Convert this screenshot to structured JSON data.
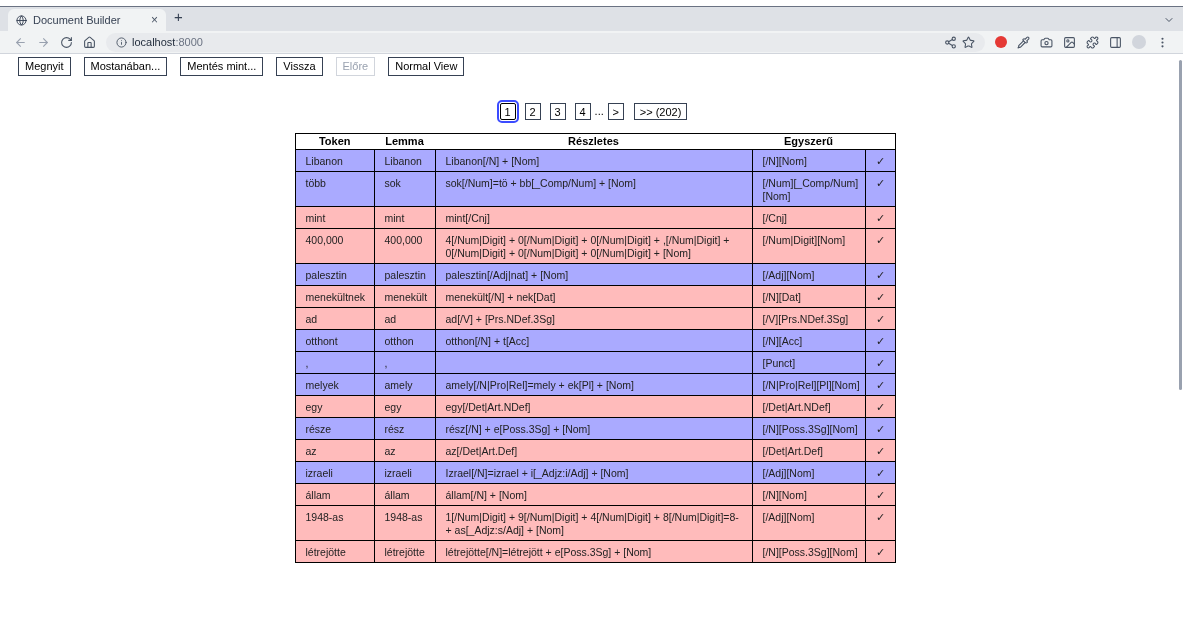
{
  "browser": {
    "tab_title": "Document Builder",
    "tab_close": "×",
    "new_tab": "+",
    "url_host": "localhost",
    "url_port": ":8000"
  },
  "toolbar": [
    {
      "label": "Megnyit",
      "disabled": false
    },
    {
      "label": "Mostanában...",
      "disabled": false
    },
    {
      "label": "Mentés mint...",
      "disabled": false
    },
    {
      "label": "Vissza",
      "disabled": false
    },
    {
      "label": "Előre",
      "disabled": true
    },
    {
      "label": "Normal View",
      "disabled": false
    }
  ],
  "pagination": {
    "pages": [
      {
        "label": "1",
        "selected": true
      },
      {
        "label": "2",
        "selected": false
      },
      {
        "label": "3",
        "selected": false
      },
      {
        "label": "4",
        "selected": false
      }
    ],
    "ellipsis": "...",
    "next": ">",
    "last": ">> (202)"
  },
  "table": {
    "columns": [
      "Token",
      "Lemma",
      "Részletes",
      "Egyszerű"
    ],
    "rows": [
      {
        "token": "Libanon",
        "lemma": "Libanon",
        "detailed": "Libanon[/N] + [Nom]",
        "simple": "[/N][Nom]",
        "check": "✓",
        "color": "#aaaaff"
      },
      {
        "token": "több",
        "lemma": "sok",
        "detailed": "sok[/Num]=tö + bb[_Comp/Num] + [Nom]",
        "simple": "[/Num][_Comp/Num][Nom]",
        "check": "✓",
        "color": "#aaaaff"
      },
      {
        "token": "mint",
        "lemma": "mint",
        "detailed": "mint[/Cnj]",
        "simple": "[/Cnj]",
        "check": "✓",
        "color": "#ffbbbb"
      },
      {
        "token": "400,000",
        "lemma": "400,000",
        "detailed": "4[/Num|Digit] + 0[/Num|Digit] + 0[/Num|Digit] + ,[/Num|Digit] + 0[/Num|Digit] + 0[/Num|Digit] + 0[/Num|Digit] + [Nom]",
        "simple": "[/Num|Digit][Nom]",
        "check": "✓",
        "color": "#ffbbbb"
      },
      {
        "token": "palesztin",
        "lemma": "palesztin",
        "detailed": "palesztin[/Adj|nat] + [Nom]",
        "simple": "[/Adj][Nom]",
        "check": "✓",
        "color": "#aaaaff"
      },
      {
        "token": "menekültnek",
        "lemma": "menekült",
        "detailed": "menekült[/N] + nek[Dat]",
        "simple": "[/N][Dat]",
        "check": "✓",
        "color": "#ffbbbb"
      },
      {
        "token": "ad",
        "lemma": "ad",
        "detailed": "ad[/V] + [Prs.NDef.3Sg]",
        "simple": "[/V][Prs.NDef.3Sg]",
        "check": "✓",
        "color": "#ffbbbb"
      },
      {
        "token": "otthont",
        "lemma": "otthon",
        "detailed": "otthon[/N] + t[Acc]",
        "simple": "[/N][Acc]",
        "check": "✓",
        "color": "#aaaaff"
      },
      {
        "token": ",",
        "lemma": ",",
        "simple": "[Punct]",
        "check": "✓",
        "color": "#aaaaff"
      },
      {
        "token": "melyek",
        "lemma": "amely",
        "detailed": "amely[/N|Pro|Rel]=mely + ek[Pl] + [Nom]",
        "simple": "[/N|Pro|Rel][Pl][Nom]",
        "check": "✓",
        "color": "#aaaaff"
      },
      {
        "token": "egy",
        "lemma": "egy",
        "detailed": "egy[/Det|Art.NDef]",
        "simple": "[/Det|Art.NDef]",
        "check": "✓",
        "color": "#ffbbbb"
      },
      {
        "token": "része",
        "lemma": "rész",
        "detailed": "rész[/N] + e[Poss.3Sg] + [Nom]",
        "simple": "[/N][Poss.3Sg][Nom]",
        "check": "✓",
        "color": "#aaaaff"
      },
      {
        "token": "az",
        "lemma": "az",
        "detailed": "az[/Det|Art.Def]",
        "simple": "[/Det|Art.Def]",
        "check": "✓",
        "color": "#ffbbbb"
      },
      {
        "token": "izraeli",
        "lemma": "izraeli",
        "detailed": "Izrael[/N]=izrael + i[_Adjz:i/Adj] + [Nom]",
        "simple": "[/Adj][Nom]",
        "check": "✓",
        "color": "#aaaaff"
      },
      {
        "token": "állam",
        "lemma": "állam",
        "detailed": "állam[/N] + [Nom]",
        "simple": "[/N][Nom]",
        "check": "✓",
        "color": "#ffbbbb"
      },
      {
        "token": "1948-as",
        "lemma": "1948-as",
        "detailed": "1[/Num|Digit] + 9[/Num|Digit] + 4[/Num|Digit] + 8[/Num|Digit]=8- + as[_Adjz:s/Adj] + [Nom]",
        "simple": "[/Adj][Nom]",
        "check": "✓",
        "color": "#ffbbbb"
      },
      {
        "token": "létrejötte",
        "lemma": "létrejötte",
        "detailed": "létrejötte[/N]=létrejött + e[Poss.3Sg] + [Nom]",
        "simple": "[/N][Poss.3Sg][Nom]",
        "check": "✓",
        "color": "#ffbbbb"
      }
    ]
  }
}
